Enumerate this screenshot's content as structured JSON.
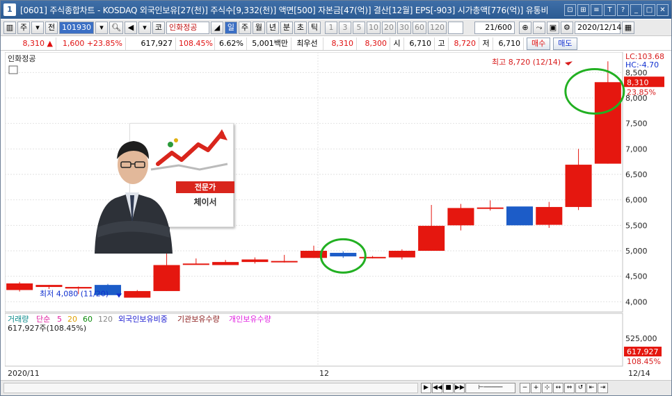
{
  "window": {
    "number": "1",
    "title": "[0601] 주식종합차트 - KOSDAQ 외국인보유[27(천)] 주식수[9,332(천)] 액면[500] 자본금[47(억)] 결산[12월] EPS[-903] 시가총액[776(억)] 유통비",
    "buttons": [
      "⊡",
      "⊞",
      "≡",
      "T",
      "?",
      "_",
      "□",
      "✕"
    ]
  },
  "toolbar": {
    "stock_code": "101930",
    "market_code": "코",
    "stock_name": "인화정공",
    "period_buttons": [
      "일",
      "주",
      "월",
      "년",
      "분",
      "초",
      "틱"
    ],
    "active_period": "일",
    "interval_buttons": [
      "1",
      "3",
      "5",
      "10",
      "20",
      "30",
      "60",
      "120"
    ],
    "count": "21/600",
    "date": "2020/12/14",
    "misc_labels": [
      "주",
      "전"
    ]
  },
  "quote": {
    "price": "8,310",
    "change": "1,600",
    "change_pct": "+23.85%",
    "volume": "617,927",
    "volume_ratio": "108.45%",
    "turnover": "6.62%",
    "amount": "5,001백만",
    "best_bid_label": "최우선",
    "ask": "8,310",
    "bid": "8,300",
    "open_label": "시",
    "open": "6,710",
    "high_label": "고",
    "high": "8,720",
    "low_label": "저",
    "low": "6,710",
    "buy_label": "매수",
    "sell_label": "매도"
  },
  "chart": {
    "panel_title": "인화정공",
    "lc_label": "LC:103.68",
    "hc_label": "HC:-4.70",
    "high_annotation": "최고 8,720 (12/14)",
    "low_annotation": "최저 4,080 (11/20)",
    "last_price_tag": "8,310",
    "last_pct_tag": "23.85%",
    "y_ticks": [
      "8,500",
      "8,000",
      "7,500",
      "7,000",
      "6,500",
      "6,000",
      "5,500",
      "5,000",
      "4,500",
      "4,000"
    ],
    "x_labels": [
      "2020/11",
      "12",
      "12/14"
    ],
    "volume_legend": [
      {
        "label": "거래량",
        "color": "#0a8a8a"
      },
      {
        "label": "단순",
        "color": "#e020a0"
      },
      {
        "label": "5",
        "color": "#e020a0"
      },
      {
        "label": "20",
        "color": "#e0a000"
      },
      {
        "label": "60",
        "color": "#0a8a0a"
      },
      {
        "label": "120",
        "color": "#888888"
      },
      {
        "label": "외국인보유비중",
        "color": "#1a1ad0"
      },
      {
        "label": "기관보유수량",
        "color": "#8a1a1a"
      },
      {
        "label": "개인보유수량",
        "color": "#e020e0"
      }
    ],
    "volume_readout": "617,927주(108.45%)",
    "volume_tick": "525,000",
    "volume_tag": "617,927",
    "volume_pct_tag": "108.45%"
  },
  "overlay": {
    "badge": "전문가",
    "name": "체이서"
  },
  "colors": {
    "up": "#e5170f",
    "down": "#1c5cc8",
    "highlight_circle": "#22b022"
  },
  "chart_data": {
    "type": "candlestick",
    "title": "인화정공",
    "x": [
      "11/16",
      "11/17",
      "11/18",
      "11/19",
      "11/20",
      "11/23",
      "11/24",
      "11/25",
      "11/26",
      "11/27",
      "11/30",
      "12/01",
      "12/02",
      "12/03",
      "12/04",
      "12/07",
      "12/08",
      "12/09",
      "12/10",
      "12/11",
      "12/14"
    ],
    "series": [
      {
        "name": "open",
        "values": [
          4230,
          4290,
          4260,
          4330,
          4080,
          4210,
          4750,
          4720,
          4780,
          4780,
          4860,
          4960,
          4870,
          4870,
          5000,
          5500,
          5850,
          5870,
          5510,
          5860,
          6710
        ]
      },
      {
        "name": "high",
        "values": [
          4390,
          4330,
          4300,
          4350,
          4230,
          4990,
          4850,
          4820,
          4870,
          4920,
          5100,
          4990,
          4900,
          5030,
          5900,
          5920,
          5990,
          5830,
          5960,
          7000,
          8720
        ]
      },
      {
        "name": "low",
        "values": [
          4200,
          4250,
          4150,
          4300,
          4080,
          4210,
          4730,
          4720,
          4750,
          4770,
          4860,
          4860,
          4850,
          4830,
          5000,
          5400,
          5790,
          5800,
          5450,
          5800,
          6710
        ]
      },
      {
        "name": "close",
        "values": [
          4360,
          4330,
          4290,
          4130,
          4210,
          4720,
          4750,
          4780,
          4830,
          4800,
          5000,
          4890,
          4880,
          5000,
          5490,
          5840,
          5850,
          5500,
          5860,
          6690,
          8310
        ]
      }
    ],
    "ylim": [
      3800,
      8900
    ],
    "grid": true
  }
}
